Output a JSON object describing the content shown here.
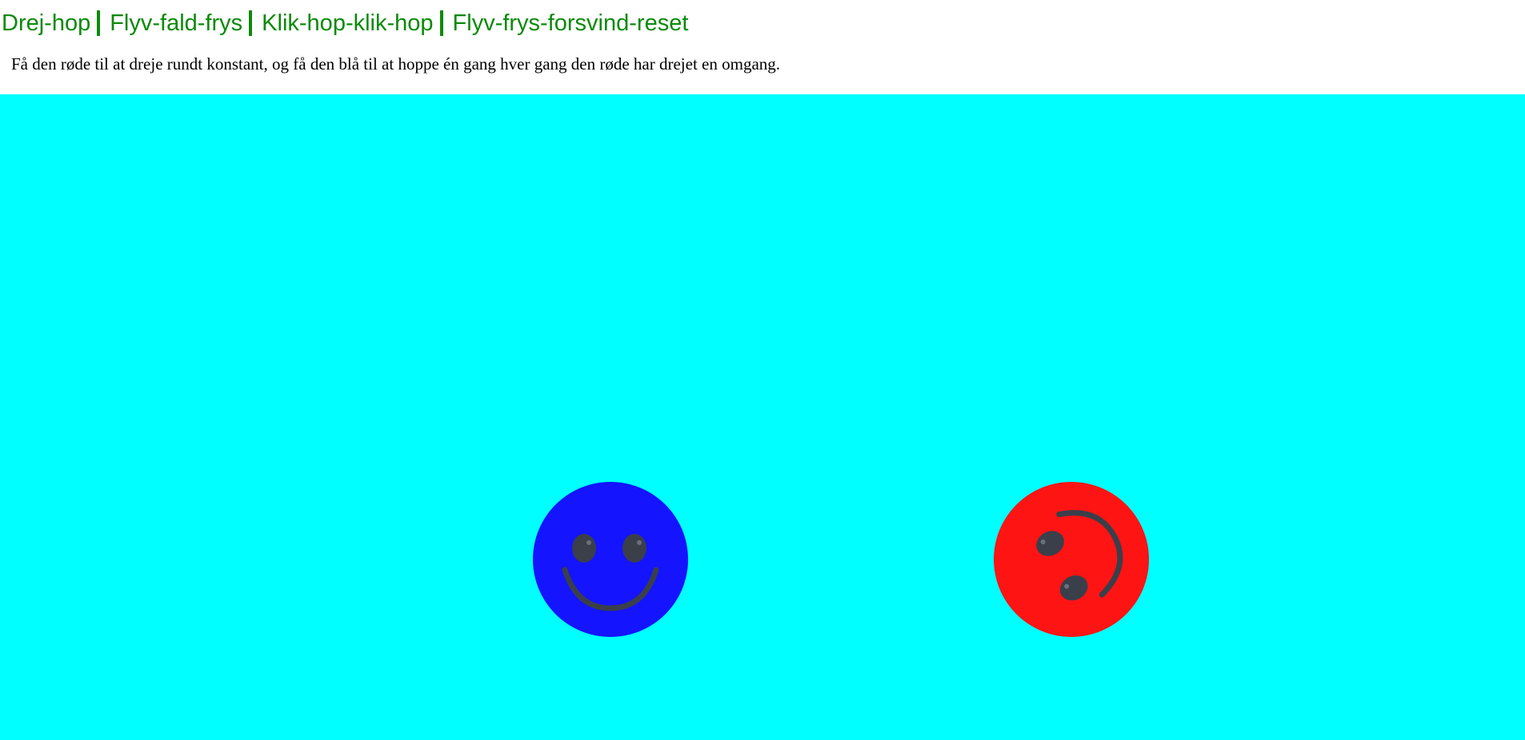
{
  "nav": {
    "items": [
      {
        "label": "Drej-hop"
      },
      {
        "label": "Flyv-fald-frys"
      },
      {
        "label": "Klik-hop-klik-hop"
      },
      {
        "label": "Flyv-frys-forsvind-reset"
      }
    ]
  },
  "instructions": "Få den røde til at dreje rundt konstant, og få den blå til at hoppe én gang hver gang den røde har drejet en omgang.",
  "stage": {
    "background": "#00ffff",
    "sprites": [
      {
        "name": "blue-smiley",
        "color": "#1414ff"
      },
      {
        "name": "red-smiley",
        "color": "#ff1414"
      }
    ]
  },
  "colors": {
    "link": "#0a8a0a",
    "face_features": "#3a3f4a"
  }
}
